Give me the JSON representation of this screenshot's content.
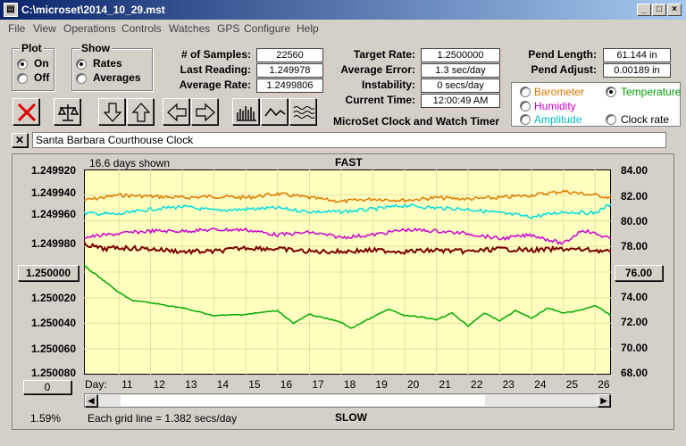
{
  "window": {
    "title": "C:\\microset\\2014_10_29.mst"
  },
  "menu": [
    "File",
    "View",
    "Operations",
    "Controls",
    "Watches",
    "GPS",
    "Configure",
    "Help"
  ],
  "plot_group": {
    "title": "Plot",
    "on": "On",
    "off": "Off",
    "selected": "On"
  },
  "show_group": {
    "title": "Show",
    "rates": "Rates",
    "averages": "Averages",
    "selected": "Rates"
  },
  "stats": {
    "samples_label": "# of Samples:",
    "samples": "22560",
    "last_label": "Last Reading:",
    "last": "1.249978",
    "avg_rate_label": "Average Rate:",
    "avg_rate": "1.2499806"
  },
  "target": {
    "target_label": "Target Rate:",
    "target": "1.2500000",
    "avg_err_label": "Average Error:",
    "avg_err": "1.3 sec/day",
    "instab_label": "Instability:",
    "instab": "0 secs/day",
    "time_label": "Current Time:",
    "time": "12:00:49 AM"
  },
  "pend": {
    "len_label": "Pend Length:",
    "len": "61.144 in",
    "adj_label": "Pend Adjust:",
    "adj": "0.00189 in"
  },
  "sensors": {
    "barometer": "Barometer",
    "temperature": "Temperature",
    "humidity": "Humidity",
    "amplitude": "Amplitude",
    "clock_rate": "Clock rate",
    "selected": "Temperature",
    "colors": {
      "barometer": "#e07800",
      "temperature": "#009900",
      "humidity": "#cc00cc",
      "amplitude": "#00cccc",
      "clock_rate": "#000000"
    }
  },
  "brand": "MicroSet Clock and Watch Timer",
  "clock_name": "Santa Barbara Courthouse Clock",
  "chart": {
    "days_shown": "16.6 days shown",
    "fast": "FAST",
    "slow": "SLOW",
    "grid_note": "Each grid line = 1.382 secs/day",
    "percent": "1.59%",
    "left_button": "1.250000",
    "bottom_left_button": "0",
    "right_button": "76.00",
    "day_label": "Day:"
  },
  "chart_data": {
    "type": "line",
    "y_left_ticks": [
      "1.249920",
      "1.249940",
      "1.249960",
      "1.249980",
      "1.250000",
      "1.250020",
      "1.250040",
      "1.250060",
      "1.250080"
    ],
    "y_left_lim": [
      1.24992,
      1.25008
    ],
    "y_right_ticks": [
      "84.00",
      "82.00",
      "80.00",
      "78.00",
      "76.00",
      "74.00",
      "72.00",
      "70.00",
      "68.00"
    ],
    "y_right_lim": [
      68,
      84
    ],
    "x_ticks": [
      11,
      12,
      13,
      14,
      15,
      16,
      17,
      18,
      19,
      20,
      21,
      22,
      23,
      24,
      25,
      26
    ],
    "x_lim": [
      9.9,
      26.5
    ],
    "grid": true,
    "series": [
      {
        "color": "#e07800",
        "axis": "right",
        "x": [
          9.9,
          11,
          12,
          13,
          14,
          15,
          16,
          17,
          18,
          19,
          20,
          21,
          22,
          23,
          24,
          25,
          26,
          26.5
        ],
        "y": [
          81.6,
          82.0,
          81.9,
          81.8,
          81.9,
          81.8,
          82.1,
          81.8,
          81.5,
          81.7,
          81.6,
          81.8,
          81.7,
          81.8,
          82.0,
          82.3,
          82.0,
          81.8
        ]
      },
      {
        "color": "#00dddd",
        "axis": "right",
        "x": [
          9.9,
          11,
          12,
          13,
          14,
          15,
          16,
          17,
          18,
          19,
          20,
          21,
          22,
          23,
          24,
          25,
          26,
          26.5
        ],
        "y": [
          80.6,
          80.5,
          80.9,
          81.1,
          80.8,
          80.9,
          81.0,
          80.7,
          80.7,
          80.9,
          81.2,
          81.0,
          80.9,
          80.6,
          80.3,
          80.7,
          80.6,
          81.3
        ]
      },
      {
        "color": "#cc00cc",
        "axis": "right",
        "x": [
          9.9,
          11,
          12,
          13,
          14,
          15,
          16,
          17,
          18,
          19,
          20,
          21,
          22,
          23,
          24,
          25,
          25.6,
          26.5
        ],
        "y": [
          78.7,
          79.0,
          79.2,
          79.2,
          79.3,
          79.3,
          78.9,
          79.1,
          78.7,
          78.9,
          79.3,
          79.2,
          79.0,
          78.6,
          78.9,
          78.2,
          79.3,
          78.6
        ]
      },
      {
        "color": "#7a0000",
        "axis": "left",
        "x": [
          9.9,
          10.5,
          11,
          12,
          13,
          14,
          15,
          16,
          17,
          18,
          19,
          20,
          21,
          22,
          23,
          24,
          25,
          26,
          26.5
        ],
        "y": [
          1.249978,
          1.249982,
          1.249981,
          1.249982,
          1.249984,
          1.249984,
          1.249981,
          1.249982,
          1.249984,
          1.249984,
          1.249983,
          1.249984,
          1.249983,
          1.249984,
          1.249982,
          1.249983,
          1.249982,
          1.249983,
          1.249984
        ]
      },
      {
        "color": "#00aa00",
        "axis": "right",
        "x": [
          9.9,
          10.6,
          11,
          11.4,
          12,
          13,
          14,
          15,
          16,
          16.5,
          17,
          17.5,
          18,
          18.3,
          19,
          19.5,
          20,
          20.5,
          21,
          21.5,
          22,
          22.5,
          23,
          23.5,
          24,
          24.5,
          25,
          25.5,
          26,
          26.5
        ],
        "y": [
          76.5,
          75.2,
          74.4,
          73.8,
          73.6,
          73.2,
          72.6,
          72.7,
          73.0,
          72.0,
          72.7,
          72.4,
          72.1,
          71.6,
          72.5,
          73.1,
          72.6,
          72.5,
          72.3,
          72.8,
          71.8,
          72.8,
          72.2,
          73.0,
          72.4,
          73.2,
          72.8,
          73.0,
          73.4,
          72.6
        ]
      }
    ]
  }
}
